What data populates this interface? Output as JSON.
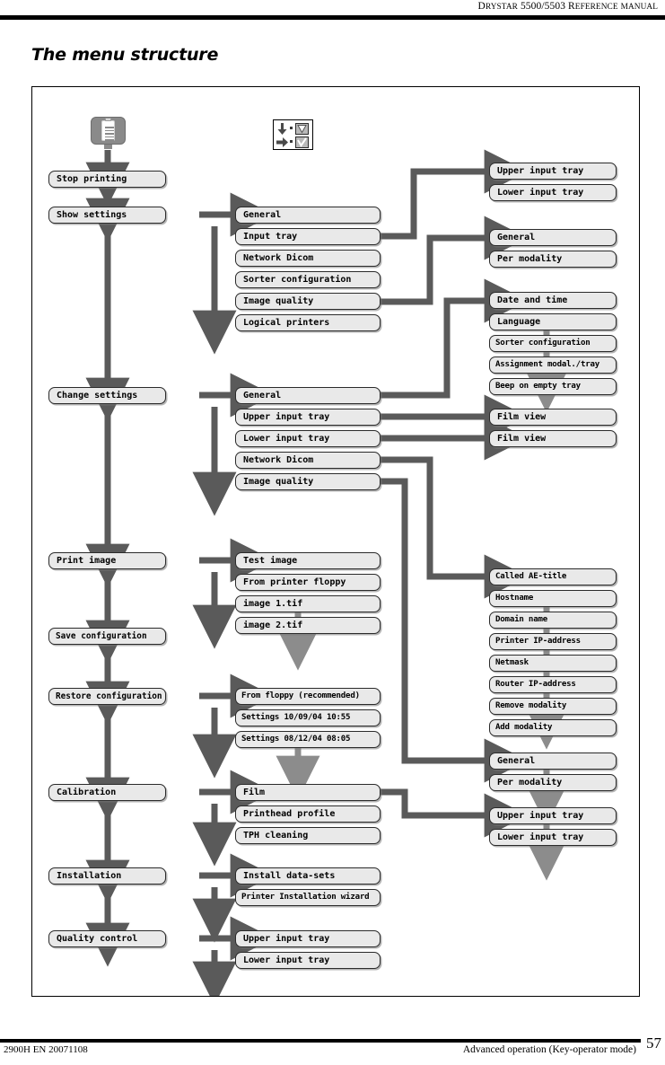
{
  "header": {
    "manual_title_main": "D",
    "manual_title": "DRYSTAR 5500/5503 REFERENCE MANUAL"
  },
  "section": {
    "title": "The menu structure"
  },
  "legend": {
    "icon_menu": "menu-clipboard-icon",
    "row1_arrow": "down-arrow",
    "row1_key": "down-triangle-key",
    "row2_arrow": "right-arrow",
    "row2_key": "checkmark-key"
  },
  "footer": {
    "left": "2900H EN 20071108",
    "center": "Advanced operation (Key-operator mode)",
    "page": "57"
  },
  "chart_data": {
    "type": "diagram",
    "title": "The menu structure",
    "nodes": {
      "main_menu": [
        "Stop printing",
        "Show settings",
        "Change settings",
        "Print image",
        "Save configuration",
        "Restore configuration",
        "Calibration",
        "Installation",
        "Quality control"
      ],
      "show_settings": [
        "General",
        "Input tray",
        "Network Dicom",
        "Sorter configuration",
        "Image quality",
        "Logical printers"
      ],
      "change_settings": [
        "General",
        "Upper input tray",
        "Lower input tray",
        "Network Dicom",
        "Image quality"
      ],
      "print_image": [
        "Test image",
        "From printer floppy",
        "image 1.tif",
        "image 2.tif"
      ],
      "restore_configuration": [
        "From floppy (recommended)",
        "Settings 10/09/04  10:55",
        "Settings 08/12/04  08:05"
      ],
      "calibration": [
        "Film",
        "Printhead profile",
        "TPH cleaning"
      ],
      "installation": [
        "Install data-sets",
        "Printer Installation wizard"
      ],
      "quality_control": [
        "Upper input tray",
        "Lower input tray"
      ],
      "input_tray_detail": [
        "Upper input tray",
        "Lower input tray"
      ],
      "image_quality_detail": [
        "General",
        "Per modality"
      ],
      "general_detail": [
        "Date and time",
        "Language",
        "Sorter configuration",
        "Assignment modal./tray",
        "Beep on empty tray"
      ],
      "film_view_upper": "Film view",
      "film_view_lower": "Film view",
      "network_dicom_detail": [
        "Called AE-title",
        "Hostname",
        "Domain name",
        "Printer IP-address",
        "Netmask",
        "Router IP-address",
        "Remove modality",
        "Add modality"
      ],
      "image_quality_detail2": [
        "General",
        "Per modality"
      ],
      "calibration_film_detail": [
        "Upper input tray",
        "Lower input tray"
      ]
    }
  }
}
